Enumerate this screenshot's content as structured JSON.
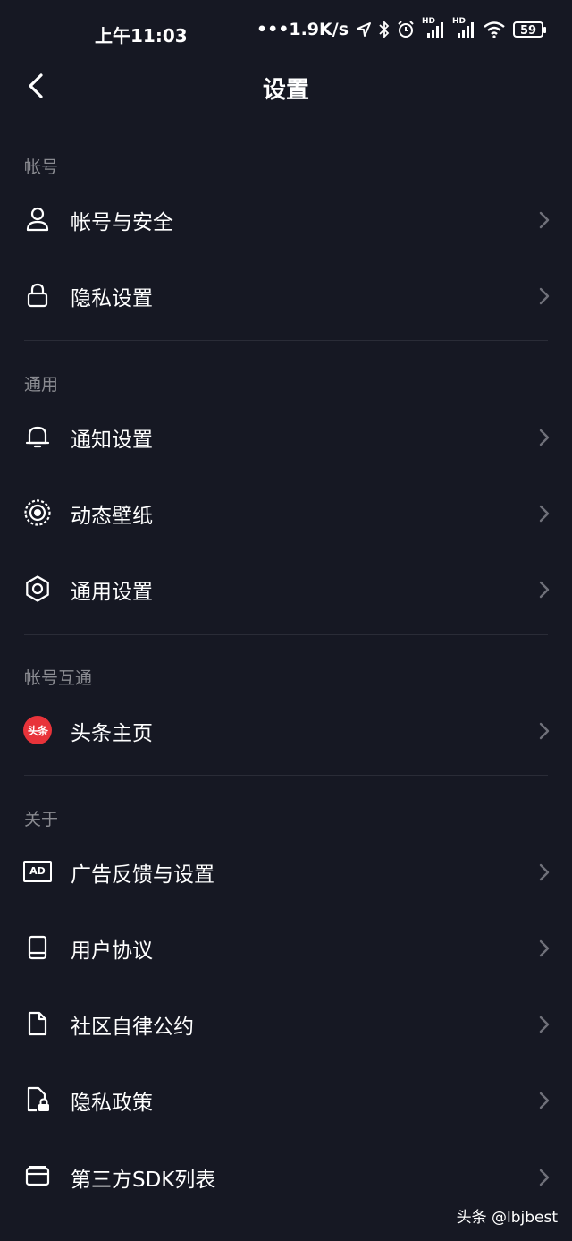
{
  "status_bar": {
    "time": "上午11:03",
    "network_speed": "•••1.9K/s",
    "signal_1_label": "HD",
    "signal_2_label": "HD",
    "battery": "59"
  },
  "header": {
    "title": "设置"
  },
  "sections": [
    {
      "title": "帐号",
      "items": [
        {
          "label": "帐号与安全",
          "icon": "user-icon"
        },
        {
          "label": "隐私设置",
          "icon": "lock-icon"
        }
      ]
    },
    {
      "title": "通用",
      "items": [
        {
          "label": "通知设置",
          "icon": "bell-icon"
        },
        {
          "label": "动态壁纸",
          "icon": "live-wallpaper-icon"
        },
        {
          "label": "通用设置",
          "icon": "gear-icon"
        }
      ]
    },
    {
      "title": "帐号互通",
      "items": [
        {
          "label": "头条主页",
          "icon": "toutiao-logo-icon",
          "badge_text": "头条"
        }
      ]
    },
    {
      "title": "关于",
      "items": [
        {
          "label": "广告反馈与设置",
          "icon": "ad-icon",
          "icon_text": "AD"
        },
        {
          "label": "用户协议",
          "icon": "book-icon"
        },
        {
          "label": "社区自律公约",
          "icon": "document-icon"
        },
        {
          "label": "隐私政策",
          "icon": "document-lock-icon"
        },
        {
          "label": "第三方SDK列表",
          "icon": "card-icon"
        }
      ]
    }
  ],
  "watermark": "头条 @lbjbest",
  "colors": {
    "background": "#161823",
    "text": "#ffffff",
    "section_header": "#8a8b91",
    "chevron": "#6f7079",
    "divider": "#2a2c37",
    "toutiao_red": "#e8333a"
  }
}
